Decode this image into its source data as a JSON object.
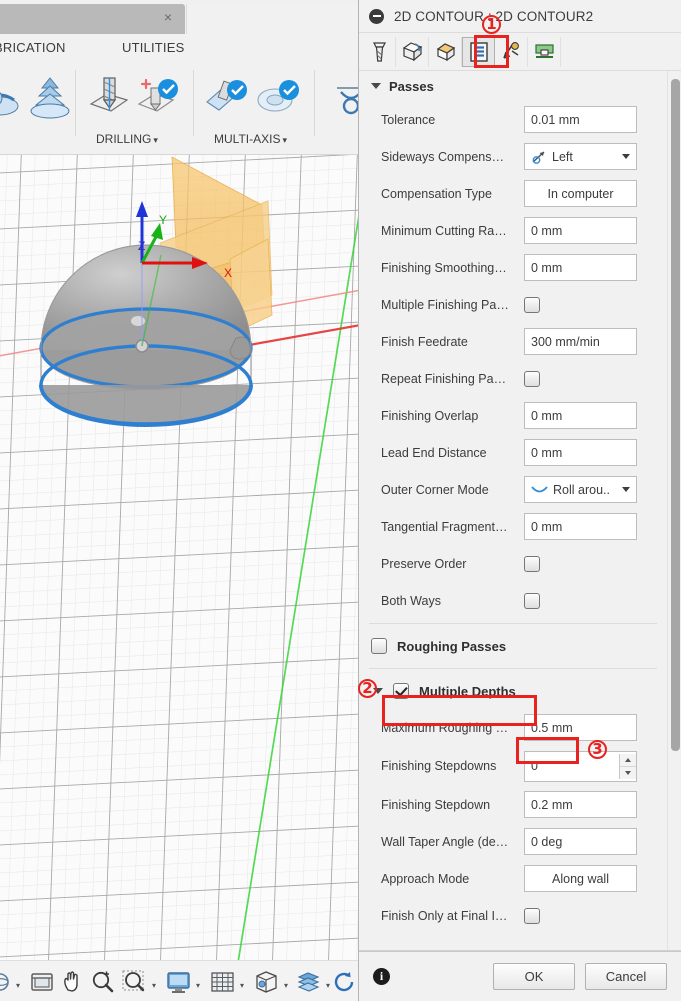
{
  "app": {
    "ribbon_tabs": [
      "BRICATION",
      "UTILITIES"
    ],
    "ribbon_groups": [
      {
        "caption": "DRILLING",
        "caret": "▾"
      },
      {
        "caption": "MULTI-AXIS",
        "caret": "▾"
      }
    ],
    "tab_close_icon": "×"
  },
  "viewport": {
    "axis_labels": {
      "x": "X",
      "y": "Y",
      "z": "Z"
    }
  },
  "navbar": {
    "items": [
      {
        "name": "orbit-icon",
        "caret": true
      },
      {
        "name": "look-at-icon",
        "caret": false
      },
      {
        "name": "pan-icon",
        "caret": false
      },
      {
        "name": "zoom-icon",
        "caret": false
      },
      {
        "name": "zoom-window-icon",
        "caret": true
      },
      {
        "name": "display-settings-icon",
        "caret": true
      },
      {
        "name": "grid-snaps-icon",
        "caret": true
      },
      {
        "name": "viewports-icon",
        "caret": true
      },
      {
        "name": "layers-icon",
        "caret": true
      },
      {
        "name": "refresh-icon",
        "caret": true
      }
    ]
  },
  "dialog": {
    "title": "2D CONTOUR : 2D CONTOUR2",
    "collapse_icon": "minus-icon",
    "tabs": [
      {
        "name": "tool-tab-icon",
        "selected": false
      },
      {
        "name": "geometry-tab-icon",
        "selected": false
      },
      {
        "name": "heights-tab-icon",
        "selected": false
      },
      {
        "name": "passes-tab-icon",
        "selected": true
      },
      {
        "name": "linking-tab-icon",
        "selected": false
      },
      {
        "name": "manual-ncc-tab-icon",
        "selected": false
      }
    ],
    "sections": [
      {
        "id": "passes",
        "header": "Passes",
        "expanded": true,
        "rows": [
          {
            "label": "Tolerance",
            "type": "text",
            "value": "0.01 mm"
          },
          {
            "label": "Sideways Compens…",
            "type": "combo-icon",
            "value": "Left",
            "icon": "sideways-left-icon"
          },
          {
            "label": "Compensation Type",
            "type": "combo-center",
            "value": "In computer"
          },
          {
            "label": "Minimum Cutting Ra…",
            "type": "text",
            "value": "0 mm"
          },
          {
            "label": "Finishing Smoothing…",
            "type": "text",
            "value": "0 mm"
          },
          {
            "label": "Multiple Finishing Pa…",
            "type": "checkbox",
            "checked": false
          },
          {
            "label": "Finish Feedrate",
            "type": "text",
            "value": "300 mm/min"
          },
          {
            "label": "Repeat Finishing Pa…",
            "type": "checkbox",
            "checked": false
          },
          {
            "label": "Finishing Overlap",
            "type": "text",
            "value": "0 mm"
          },
          {
            "label": "Lead End Distance",
            "type": "text",
            "value": "0 mm"
          },
          {
            "label": "Outer Corner Mode",
            "type": "combo-icon",
            "value": "Roll arou..",
            "icon": "roll-around-icon"
          },
          {
            "label": "Tangential Fragment…",
            "type": "text",
            "value": "0 mm"
          },
          {
            "label": "Preserve Order",
            "type": "checkbox",
            "checked": false
          },
          {
            "label": "Both Ways",
            "type": "checkbox",
            "checked": false
          }
        ]
      },
      {
        "id": "roughing-passes",
        "header": "Roughing Passes",
        "checked": false,
        "rows": []
      },
      {
        "id": "multiple-depths",
        "header": "Multiple Depths",
        "checked": true,
        "expanded": true,
        "rows": [
          {
            "label": "Maximum Roughing …",
            "type": "text",
            "value": "0.5 mm"
          },
          {
            "label": "Finishing Stepdowns",
            "type": "spinner",
            "value": "0"
          },
          {
            "label": "Finishing Stepdown",
            "type": "text",
            "value": "0.2 mm"
          },
          {
            "label": "Wall Taper Angle (de…",
            "type": "text",
            "value": "0 deg"
          },
          {
            "label": "Approach Mode",
            "type": "combo-center",
            "value": "Along wall"
          },
          {
            "label": "Finish Only at Final I…",
            "type": "checkbox",
            "checked": false
          }
        ]
      }
    ],
    "footer": {
      "info_icon": "i",
      "ok_label": "OK",
      "cancel_label": "Cancel"
    }
  },
  "annotations": {
    "markers": [
      {
        "id": "1",
        "label": "①"
      },
      {
        "id": "2",
        "label": "②"
      },
      {
        "id": "3",
        "label": "③"
      }
    ],
    "color": "#e8221f"
  }
}
